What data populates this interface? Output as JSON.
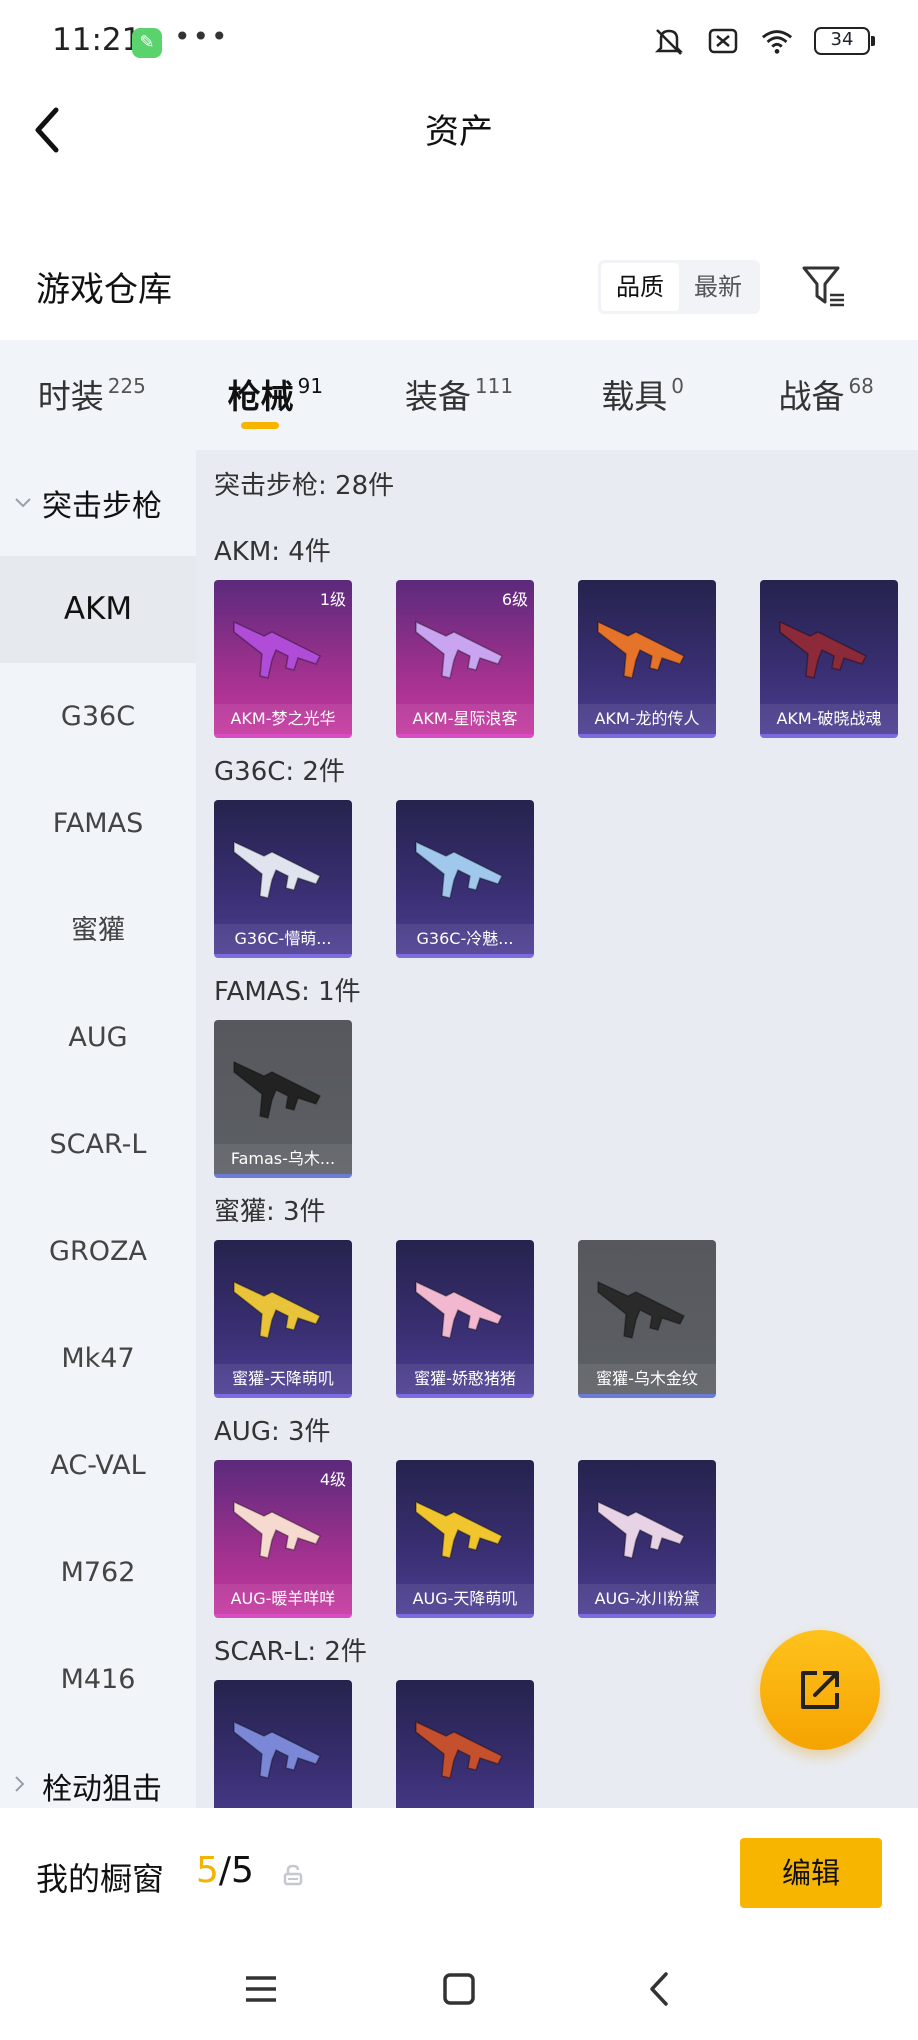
{
  "status_bar": {
    "time": "11:21",
    "battery": "34",
    "more": "•••"
  },
  "header": {
    "title": "资产"
  },
  "warehouse": {
    "title": "游戏仓库",
    "sort_options": [
      "品质",
      "最新"
    ],
    "active_sort": "品质"
  },
  "tabs": [
    {
      "label": "时装",
      "count": "225"
    },
    {
      "label": "枪械",
      "count": "91",
      "active": true
    },
    {
      "label": "装备",
      "count": "111"
    },
    {
      "label": "载具",
      "count": "0"
    },
    {
      "label": "战备",
      "count": "68"
    }
  ],
  "sidebar": {
    "group_open": "突击步枪",
    "items": [
      "AKM",
      "G36C",
      "FAMAS",
      "蜜獾",
      "AUG",
      "SCAR-L",
      "GROZA",
      "Mk47",
      "AC-VAL",
      "M762",
      "M416"
    ],
    "active_item": "AKM",
    "group_closed": "栓动狙击"
  },
  "main": {
    "total": "突击步枪: 28件",
    "groups": [
      {
        "title": "AKM: 4件",
        "items": [
          {
            "name": "AKM-梦之光华",
            "level": "1级",
            "quality": "pink",
            "gun": "#b04cd8"
          },
          {
            "name": "AKM-星际浪客",
            "level": "6级",
            "quality": "pink",
            "gun": "#c9a4f0"
          },
          {
            "name": "AKM-龙的传人",
            "level": "",
            "quality": "purple",
            "gun": "#e6732a"
          },
          {
            "name": "AKM-破晓战魂",
            "level": "",
            "quality": "purple",
            "gun": "#8c2a3a"
          }
        ]
      },
      {
        "title": "G36C: 2件",
        "items": [
          {
            "name": "G36C-懵萌...",
            "level": "",
            "quality": "purple",
            "gun": "#dfe4ee"
          },
          {
            "name": "G36C-冷魅...",
            "level": "",
            "quality": "purple",
            "gun": "#9fc8ec"
          }
        ]
      },
      {
        "title": "FAMAS: 1件",
        "items": [
          {
            "name": "Famas-乌木...",
            "level": "",
            "quality": "gray",
            "gun": "#222222"
          }
        ]
      },
      {
        "title": "蜜獾: 3件",
        "items": [
          {
            "name": "蜜獾-天降萌叽",
            "level": "",
            "quality": "purple",
            "gun": "#e9c33a"
          },
          {
            "name": "蜜獾-娇憨猪猪",
            "level": "",
            "quality": "purple",
            "gun": "#f2b8cf"
          },
          {
            "name": "蜜獾-乌木金纹",
            "level": "",
            "quality": "gray",
            "gun": "#2a2a2a"
          }
        ]
      },
      {
        "title": "AUG: 3件",
        "items": [
          {
            "name": "AUG-暖羊咩咩",
            "level": "4级",
            "quality": "pink",
            "gun": "#f6d9cf"
          },
          {
            "name": "AUG-天降萌叽",
            "level": "",
            "quality": "purple",
            "gun": "#f0c52e"
          },
          {
            "name": "AUG-冰川粉黛",
            "level": "",
            "quality": "purple",
            "gun": "#e8d3e6"
          }
        ]
      },
      {
        "title": "SCAR-L: 2件",
        "items": [
          {
            "name": "",
            "level": "",
            "quality": "purple",
            "gun": "#7b88d8"
          },
          {
            "name": "",
            "level": "",
            "quality": "purple",
            "gun": "#c4502e"
          }
        ]
      }
    ]
  },
  "showcase": {
    "label": "我的橱窗",
    "current": "5",
    "slash": "/",
    "max": "5",
    "edit_label": "编辑"
  },
  "colors": {
    "accent": "#f7b500",
    "sidebar_bg": "#f1f5fa",
    "grid_bg": "#e8ecf2"
  }
}
